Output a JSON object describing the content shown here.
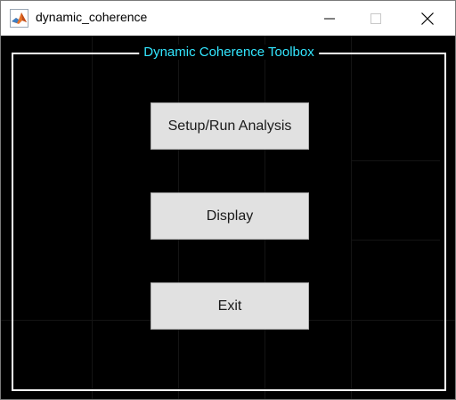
{
  "window": {
    "title": "dynamic_coherence",
    "app_icon": "matlab-icon",
    "controls": {
      "minimize_icon": "minimize-icon",
      "maximize_icon": "maximize-icon",
      "close_icon": "close-icon"
    }
  },
  "panel": {
    "title": "Dynamic Coherence Toolbox",
    "title_color": "#33e6ff"
  },
  "buttons": {
    "setup_run": "Setup/Run Analysis",
    "display": "Display",
    "exit": "Exit"
  },
  "colors": {
    "background": "#000000",
    "frame": "#ffffff",
    "button_face": "#e1e1e1"
  }
}
